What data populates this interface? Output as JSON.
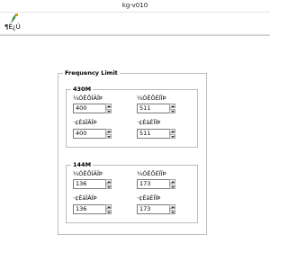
{
  "window": {
    "title": "kg-v010"
  },
  "toolbar": {
    "button_label": "¶Ë¿Ú",
    "button_icon": "lightning-plug-icon"
  },
  "frequency_limit": {
    "title": "Frequency Limit",
    "band_430": {
      "title": "430M",
      "rx_low_label": "¼ÓÊÕÏÂÏÞ",
      "rx_low_value": "400",
      "rx_high_label": "¼ÓÊÕÉÏÏÞ",
      "rx_high_value": "511",
      "tx_low_label": "·¢ÉäÏÂÏÞ",
      "tx_low_value": "400",
      "tx_high_label": "·¢ÉäÉÏÏÞ",
      "tx_high_value": "511"
    },
    "band_144": {
      "title": "144M",
      "rx_low_label": "¼ÓÊÕÏÂÏÞ",
      "rx_low_value": "136",
      "rx_high_label": "¼ÓÊÕÉÏÏÞ",
      "rx_high_value": "173",
      "tx_low_label": "·¢ÉäÏÂÏÞ",
      "tx_low_value": "136",
      "tx_high_label": "·¢ÉäÉÏÏÞ",
      "tx_high_value": "173"
    }
  }
}
